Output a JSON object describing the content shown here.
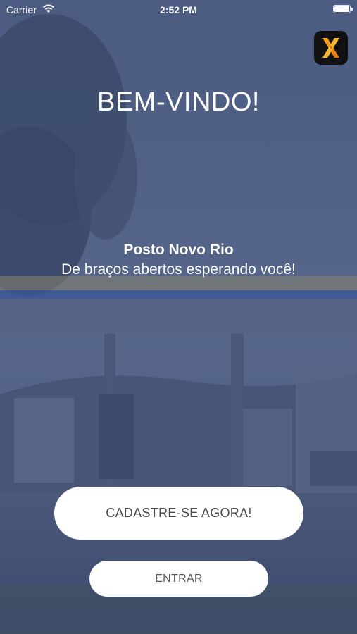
{
  "status_bar": {
    "carrier": "Carrier",
    "time": "2:52 PM",
    "icons": [
      "wifi-icon",
      "battery-icon"
    ]
  },
  "app_badge": {
    "icon": "x-logo-icon",
    "colors": [
      "#f5a623",
      "#e8710a",
      "#111111"
    ]
  },
  "welcome": {
    "title": "BEM-VINDO!",
    "station_name": "Posto Novo Rio",
    "tagline": "De braços abertos esperando você!"
  },
  "buttons": {
    "register_label": "CADASTRE-SE AGORA!",
    "login_label": "ENTRAR"
  },
  "colors": {
    "overlay": "#3a4a76",
    "button_bg": "#ffffff",
    "button_text": "#4a4a4a"
  }
}
